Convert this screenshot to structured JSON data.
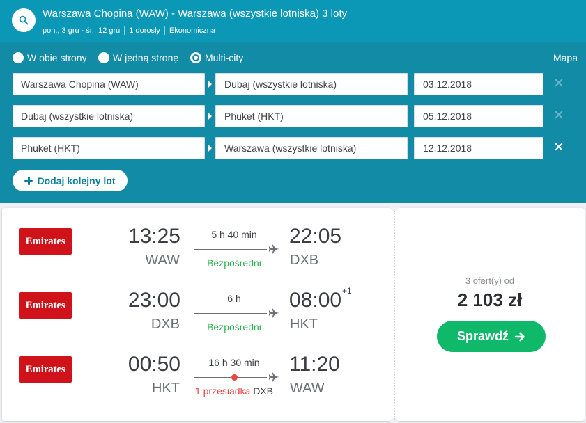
{
  "header": {
    "route": "Warszawa Chopina (WAW) - Warszawa (wszystkie lotniska) 3 loty",
    "dates": "pon., 3 gru - śr., 12 gru",
    "passengers": "1 dorosły",
    "cabin": "Ekonomiczna",
    "search_icon": "search-icon"
  },
  "form": {
    "trip_types": [
      {
        "label": "W obie strony",
        "selected": false
      },
      {
        "label": "W jedną stronę",
        "selected": false
      },
      {
        "label": "Multi-city",
        "selected": true
      }
    ],
    "map_label": "Mapa",
    "legs": [
      {
        "from": "Warszawa Chopina (WAW)",
        "to": "Dubaj (wszystkie lotniska)",
        "date": "03.12.2018"
      },
      {
        "from": "Dubaj (wszystkie lotniska)",
        "to": "Phuket (HKT)",
        "date": "05.12.2018"
      },
      {
        "from": "Phuket (HKT)",
        "to": "Warszawa (wszystkie lotniska)",
        "date": "12.12.2018"
      }
    ],
    "add_leg_label": "Dodaj kolejny lot"
  },
  "result": {
    "flights": [
      {
        "airline": "Emirates",
        "dep_time": "13:25",
        "dep_code": "WAW",
        "duration": "5 h 40 min",
        "arr_time": "22:05",
        "arr_code": "DXB",
        "stops_label": "Bezpośredni",
        "stop_airport": "",
        "day_offset": ""
      },
      {
        "airline": "Emirates",
        "dep_time": "23:00",
        "dep_code": "DXB",
        "duration": "6 h",
        "arr_time": "08:00",
        "arr_code": "HKT",
        "stops_label": "Bezpośredni",
        "stop_airport": "",
        "day_offset": "+1"
      },
      {
        "airline": "Emirates",
        "dep_time": "00:50",
        "dep_code": "HKT",
        "duration": "16 h 30 min",
        "arr_time": "11:20",
        "arr_code": "WAW",
        "stops_label": "1 przesiadka",
        "stop_airport": "DXB",
        "day_offset": ""
      }
    ],
    "offers_label": "3 ofert(y) od",
    "price": "2 103 zł",
    "check_label": "Sprawdź"
  },
  "colors": {
    "header_bg": "#0b98b7",
    "form_bg": "#128ba6",
    "direct": "#2bb24c",
    "stop": "#e84545",
    "cta": "#10b86a",
    "airline": "#d0121b"
  }
}
